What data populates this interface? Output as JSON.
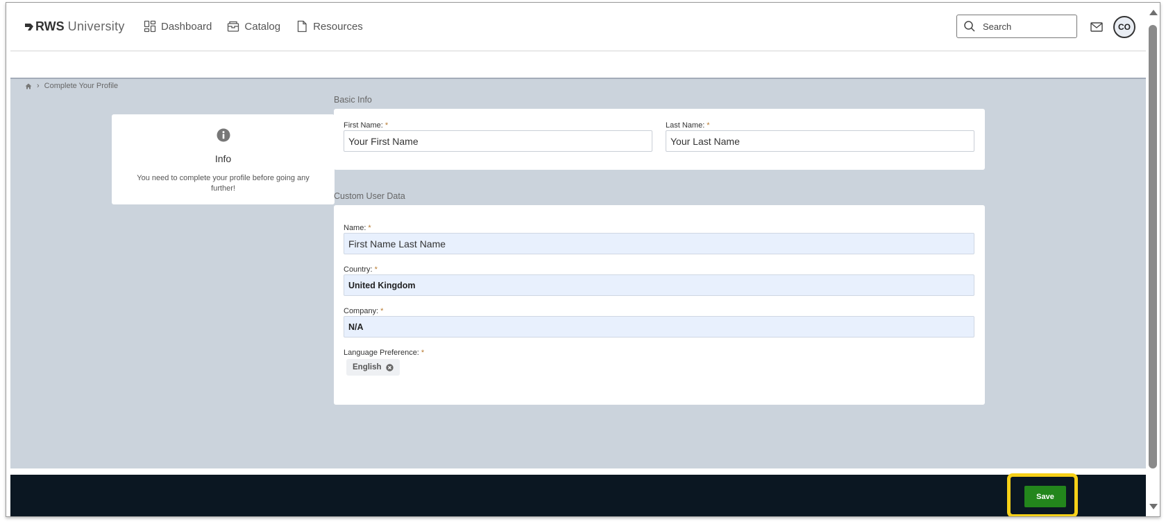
{
  "header": {
    "brand_bold": "RWS",
    "brand_light": "University",
    "nav": [
      {
        "label": "Dashboard",
        "icon": "dashboard-icon"
      },
      {
        "label": "Catalog",
        "icon": "catalog-icon"
      },
      {
        "label": "Resources",
        "icon": "document-icon"
      }
    ],
    "search_placeholder": "Search",
    "avatar_initials": "CO"
  },
  "breadcrumb": {
    "home_icon": "home-icon",
    "current": "Complete Your Profile"
  },
  "info_card": {
    "title": "Info",
    "message": "You need to complete your profile before going any further!"
  },
  "basic_info": {
    "section_title": "Basic Info",
    "first_name_label": "First Name:",
    "first_name_value": "Your First Name",
    "last_name_label": "Last Name:",
    "last_name_value": "Your Last Name",
    "required_mark": "*"
  },
  "custom_data": {
    "section_title": "Custom User Data",
    "name_label": "Name:",
    "name_value": "First Name Last Name",
    "country_label": "Country:",
    "country_value": "United Kingdom",
    "company_label": "Company:",
    "company_value": "N/A",
    "language_label": "Language Preference:",
    "language_tag": "English"
  },
  "footer": {
    "save_label": "Save",
    "highlight_color": "#f6d018",
    "save_color": "#23861c"
  }
}
